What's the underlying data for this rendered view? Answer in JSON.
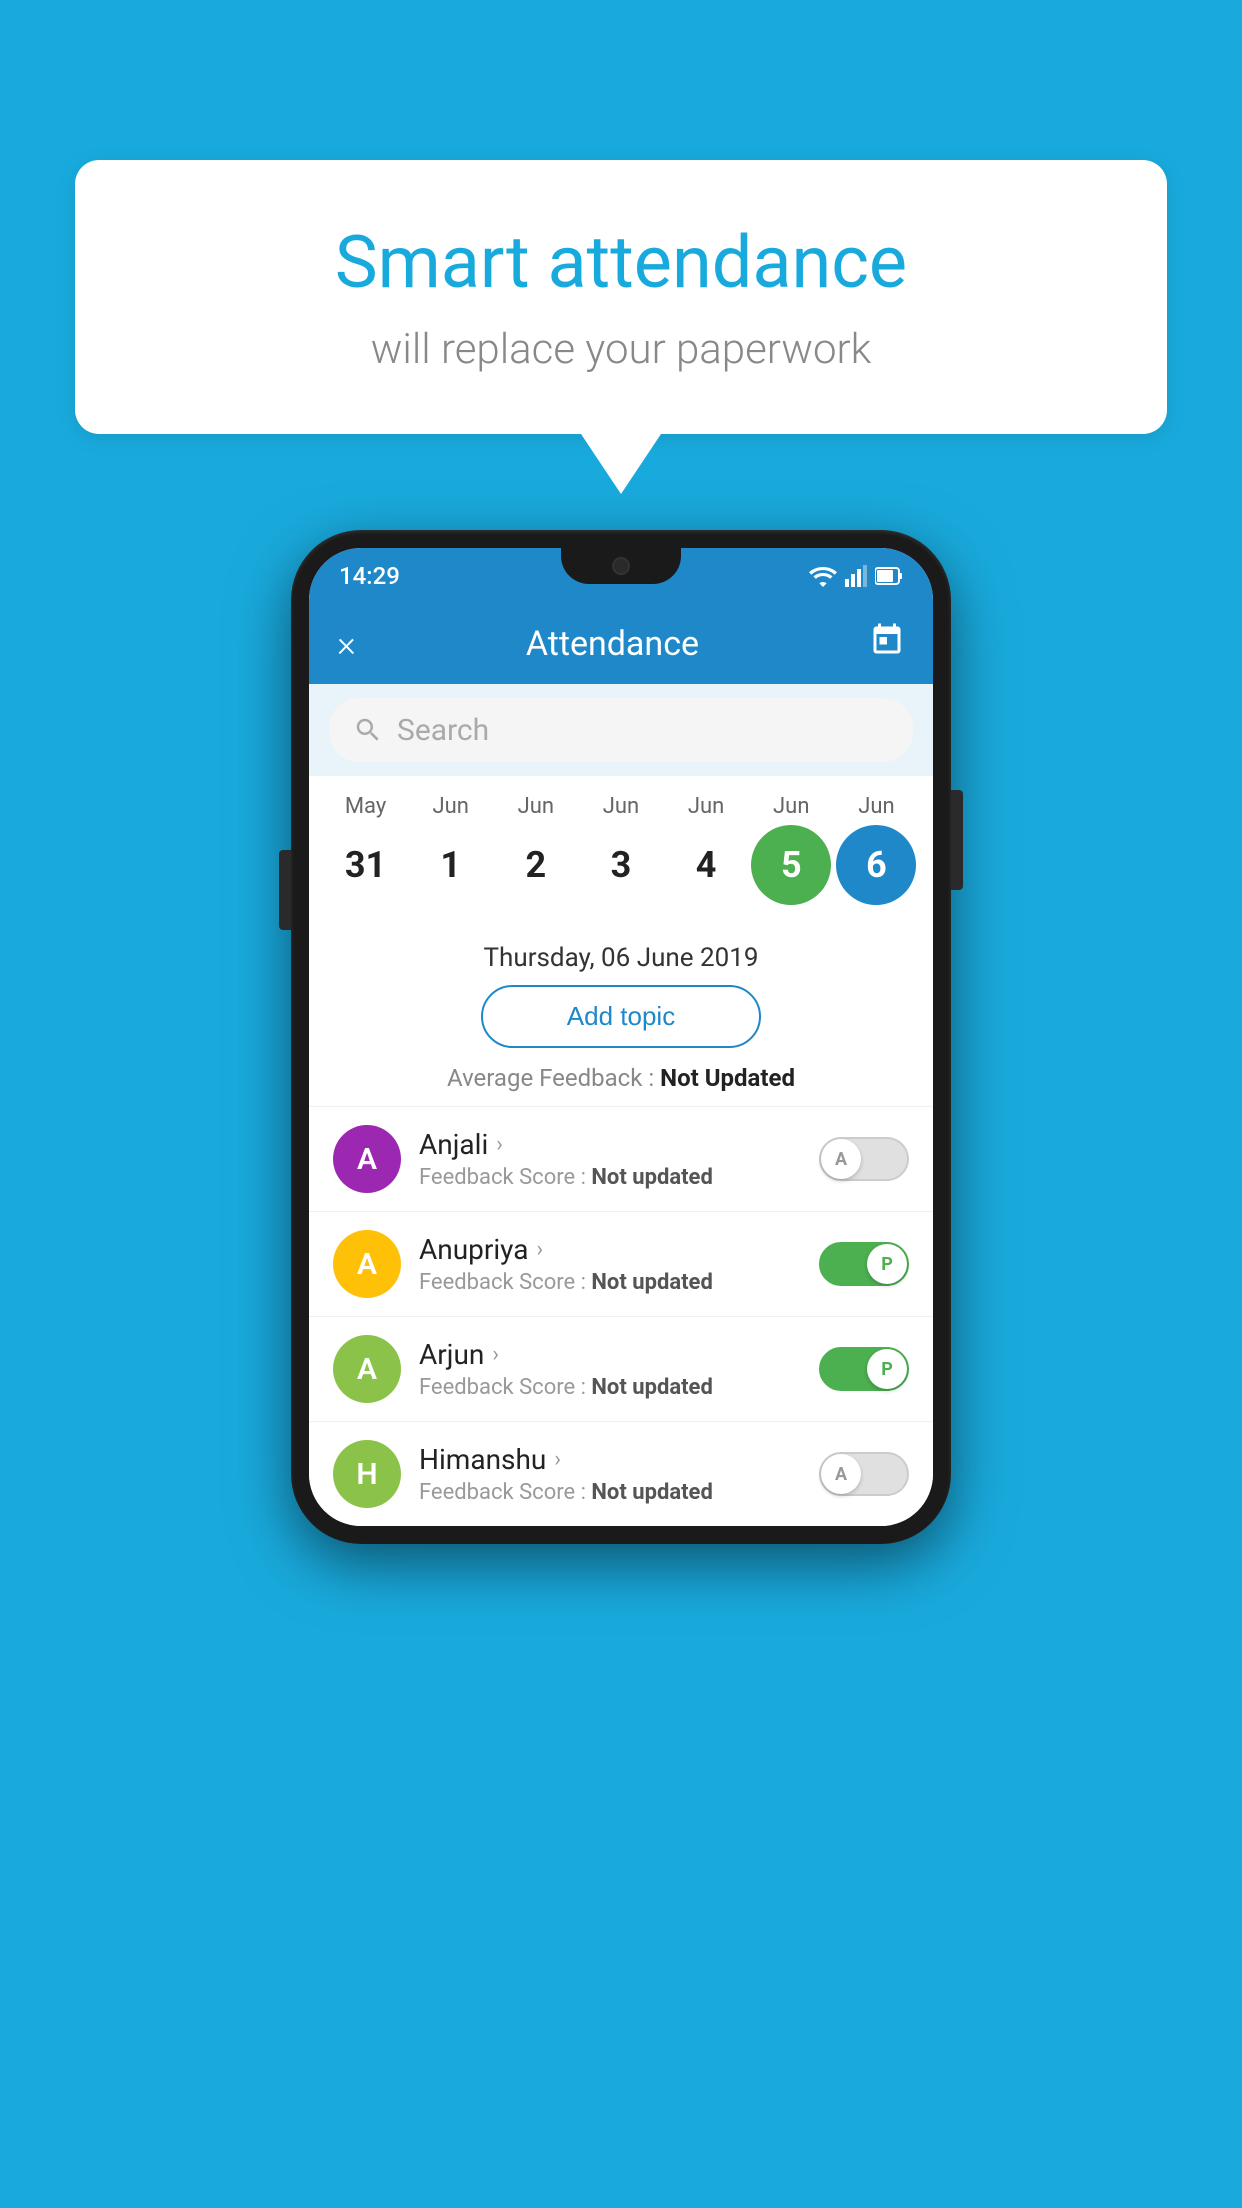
{
  "background_color": "#19AADD",
  "speech_bubble": {
    "title": "Smart attendance",
    "subtitle": "will replace your paperwork"
  },
  "status_bar": {
    "time": "14:29"
  },
  "app_header": {
    "title": "Attendance",
    "close_label": "×",
    "calendar_icon": "calendar-icon"
  },
  "search": {
    "placeholder": "Search"
  },
  "calendar": {
    "months": [
      "May",
      "Jun",
      "Jun",
      "Jun",
      "Jun",
      "Jun",
      "Jun"
    ],
    "dates": [
      "31",
      "1",
      "2",
      "3",
      "4",
      "5",
      "6"
    ],
    "states": [
      "normal",
      "normal",
      "normal",
      "normal",
      "normal",
      "today",
      "selected"
    ]
  },
  "selected_date_display": "Thursday, 06 June 2019",
  "add_topic_label": "Add topic",
  "avg_feedback_label": "Average Feedback : ",
  "avg_feedback_value": "Not Updated",
  "students": [
    {
      "name": "Anjali",
      "avatar_letter": "A",
      "avatar_color": "#9C27B0",
      "feedback_label": "Feedback Score : ",
      "feedback_value": "Not updated",
      "toggle_state": "off",
      "toggle_label": "A"
    },
    {
      "name": "Anupriya",
      "avatar_letter": "A",
      "avatar_color": "#FFC107",
      "feedback_label": "Feedback Score : ",
      "feedback_value": "Not updated",
      "toggle_state": "on",
      "toggle_label": "P"
    },
    {
      "name": "Arjun",
      "avatar_letter": "A",
      "avatar_color": "#8BC34A",
      "feedback_label": "Feedback Score : ",
      "feedback_value": "Not updated",
      "toggle_state": "on",
      "toggle_label": "P"
    },
    {
      "name": "Himanshu",
      "avatar_letter": "H",
      "avatar_color": "#8BC34A",
      "feedback_label": "Feedback Score : ",
      "feedback_value": "Not updated",
      "toggle_state": "off",
      "toggle_label": "A"
    }
  ]
}
